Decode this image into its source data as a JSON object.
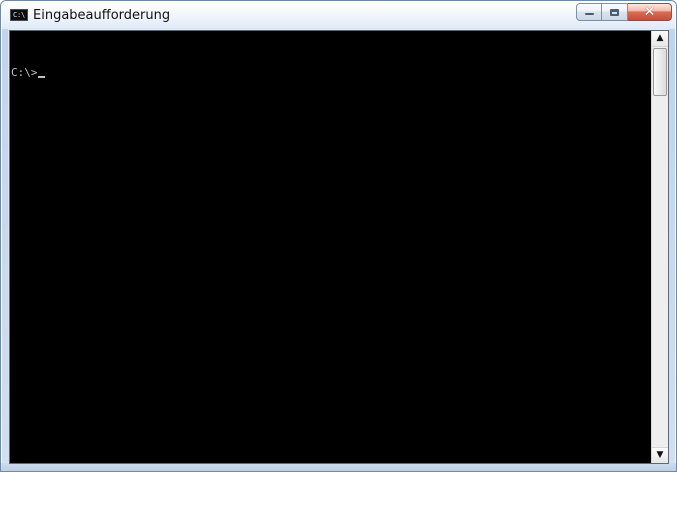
{
  "window": {
    "title": "Eingabeaufforderung",
    "icon": "command-prompt-icon",
    "controls": {
      "minimize_icon": "minimize-icon",
      "maximize_icon": "maximize-icon",
      "close_icon": "close-icon",
      "close_glyph": "✕"
    }
  },
  "console": {
    "prompt": "C:\\>"
  },
  "colors": {
    "console_background": "#000000",
    "console_text": "#c0c0c0",
    "title_text": "#111111",
    "close_button": "#c74d39"
  }
}
